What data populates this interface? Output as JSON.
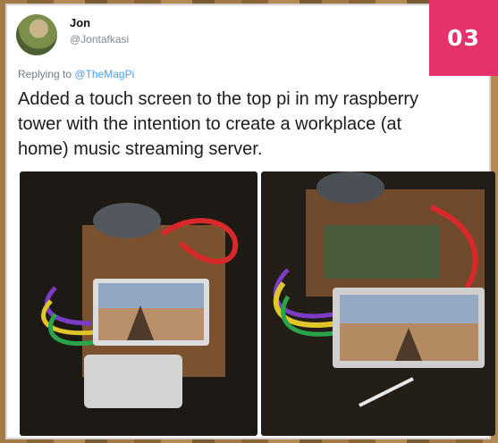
{
  "badge": {
    "label": "03"
  },
  "author": {
    "name": "Jon",
    "handle": "@Jontafkasi"
  },
  "reply": {
    "prefix": "Replying to ",
    "mention": "@TheMagPi"
  },
  "tweet": {
    "text": "Added a touch screen to the top pi in my raspberry tower with the intention to create a workplace (at home) music streaming server."
  },
  "media": [
    {
      "name": "photo-left"
    },
    {
      "name": "photo-right"
    }
  ],
  "colors": {
    "badge": "#e4336b",
    "mention": "#4a9ee8",
    "handle": "#7d8a97"
  }
}
